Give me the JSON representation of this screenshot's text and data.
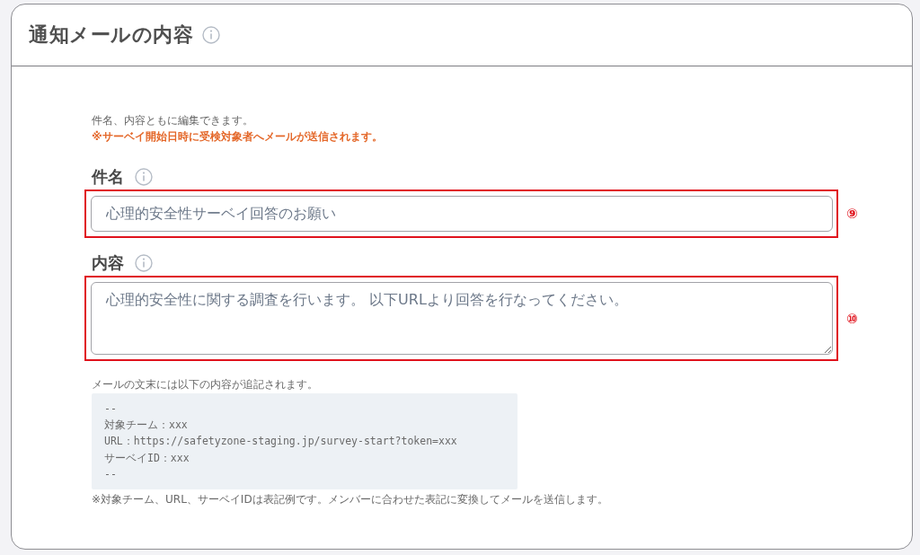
{
  "panel": {
    "title": "通知メールの内容"
  },
  "intro": {
    "note": "件名、内容ともに編集できます。",
    "warning": "※サーベイ開始日時に受検対象者へメールが送信されます。"
  },
  "fields": [
    {
      "kind": "input",
      "label": "件名",
      "value": "心理的安全性サーベイ回答のお願い",
      "annotation": "⑨"
    },
    {
      "kind": "textarea",
      "label": "内容",
      "value": "心理的安全性に関する調査を行います。 以下URLより回答を行なってください。",
      "annotation": "⑩"
    }
  ],
  "appendix": {
    "note": "メールの文末には以下の内容が追記されます。",
    "lines": [
      "--",
      "対象チーム：xxx",
      "URL：https://safetyzone-staging.jp/survey-start?token=xxx",
      "サーベイID：xxx",
      "--"
    ],
    "footnote": "※対象チーム、URL、サーベイIDは表記例です。メンバーに合わせた表記に変換してメールを送信します。"
  }
}
